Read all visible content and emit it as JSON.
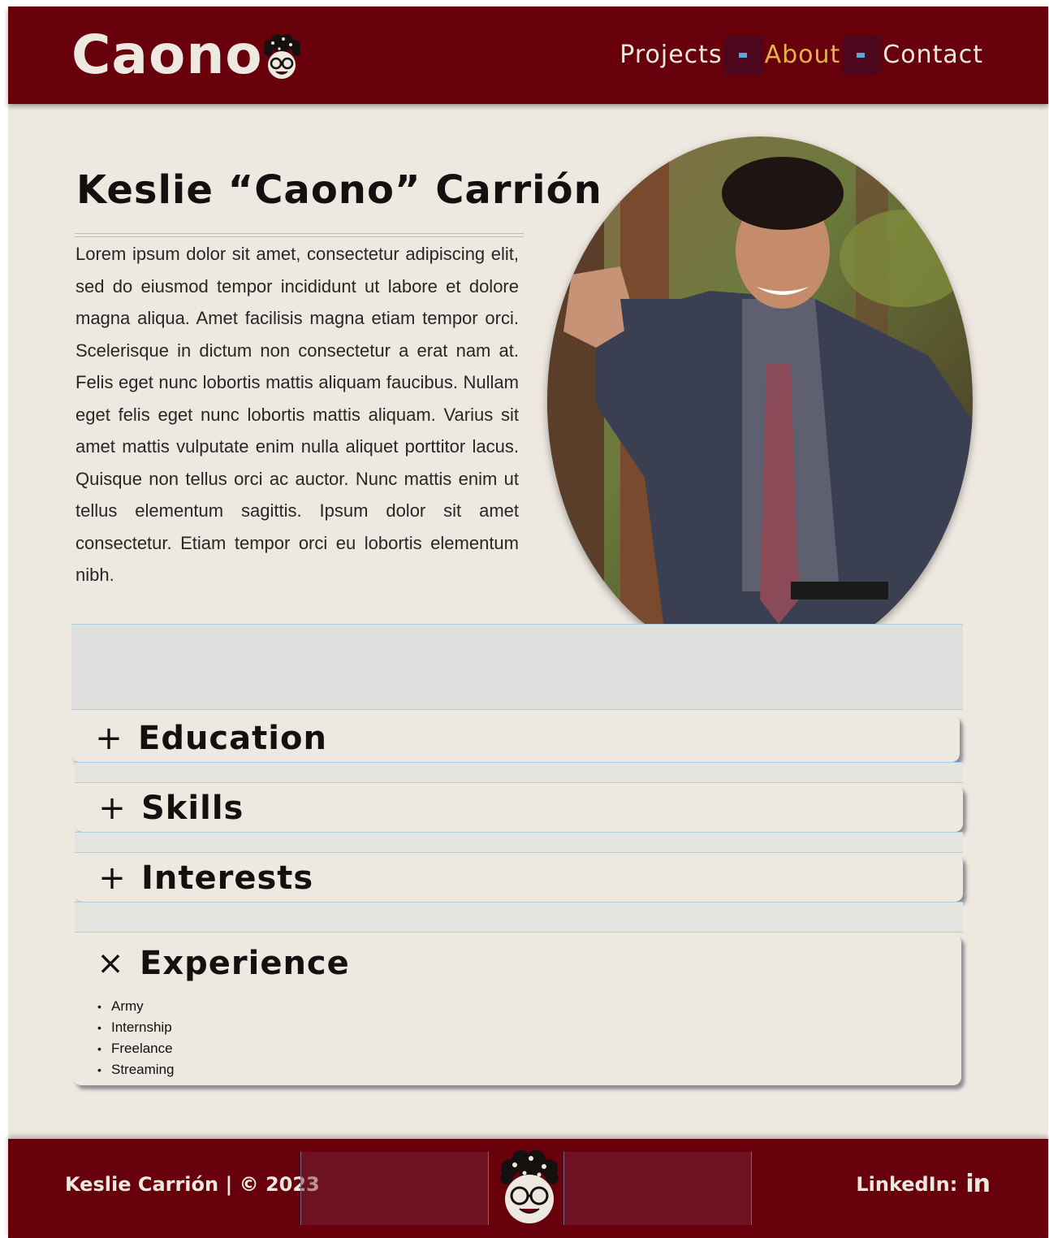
{
  "header": {
    "logo_text": "Caono",
    "logo_icon": "curly-hair-face-logo",
    "nav": [
      {
        "label": "Projects",
        "active": false
      },
      {
        "label": "About",
        "active": true
      },
      {
        "label": "Contact",
        "active": false
      }
    ]
  },
  "about": {
    "name": "Keslie “Caono” Carrión",
    "bio": "Lorem ipsum dolor sit amet, consectetur adipiscing elit, sed do eiusmod tempor incididunt ut labore et dolore magna aliqua. Amet facilisis magna etiam tempor orci. Scelerisque in dictum non consectetur a erat nam at. Felis eget nunc lobortis mattis aliquam faucibus. Nullam eget felis eget nunc lobortis mattis aliquam. Varius sit amet mattis vulputate enim nulla aliquet porttitor lacus. Quisque non tellus orci ac auctor. Nunc mattis enim ut tellus elementum sagittis. Ipsum dolor sit amet consectetur. Etiam tempor orci eu lobortis elementum nibh.",
    "photo": "portrait-photo"
  },
  "accordion": [
    {
      "label": "Education",
      "icon": "+",
      "expanded": false,
      "items": []
    },
    {
      "label": "Skills",
      "icon": "+",
      "expanded": false,
      "items": []
    },
    {
      "label": "Interests",
      "icon": "+",
      "expanded": false,
      "items": []
    },
    {
      "label": "Experience",
      "icon": "×",
      "expanded": true,
      "items": [
        "Army",
        "Internship",
        "Freelance",
        "Streaming"
      ]
    }
  ],
  "footer": {
    "copyright": "Keslie Carrión | © 2023",
    "linkedin_label": "LinkedIn:",
    "linkedin_icon": "in"
  },
  "colors": {
    "brand": "#67000b",
    "background": "#ede8e0",
    "accent": "#e4b24c"
  }
}
